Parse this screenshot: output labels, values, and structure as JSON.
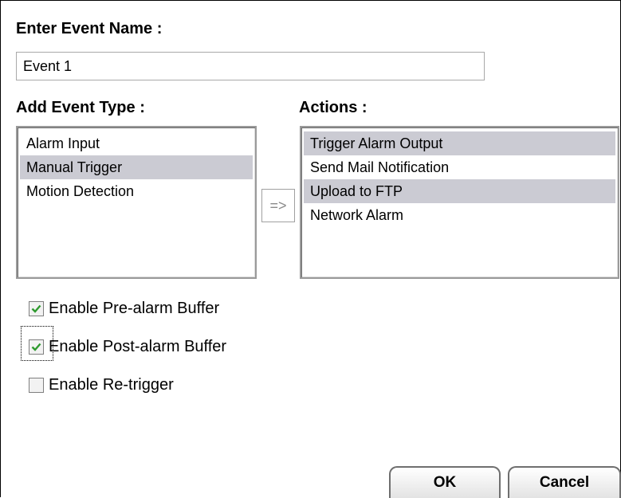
{
  "event_name": {
    "label": "Enter Event Name :",
    "value": "Event 1"
  },
  "event_type": {
    "label": "Add Event Type :",
    "items": [
      {
        "label": "Alarm Input",
        "selected": false
      },
      {
        "label": "Manual Trigger",
        "selected": true
      },
      {
        "label": "Motion Detection",
        "selected": false
      }
    ]
  },
  "transfer_button": {
    "label": "=>"
  },
  "actions": {
    "label": "Actions :",
    "items": [
      {
        "label": "Trigger Alarm Output",
        "selected": true
      },
      {
        "label": "Send Mail Notification",
        "selected": false
      },
      {
        "label": "Upload to FTP",
        "selected": true
      },
      {
        "label": "Network Alarm",
        "selected": false
      }
    ]
  },
  "options": {
    "pre_alarm": {
      "label": "Enable Pre-alarm Buffer",
      "checked": true
    },
    "post_alarm": {
      "label": "Enable Post-alarm Buffer",
      "checked": true
    },
    "retrigger": {
      "label": "Enable Re-trigger",
      "checked": false
    }
  },
  "buttons": {
    "ok": "OK",
    "cancel": "Cancel"
  },
  "colors": {
    "selection": "#cbcbd3",
    "check": "#2e9a2e"
  }
}
